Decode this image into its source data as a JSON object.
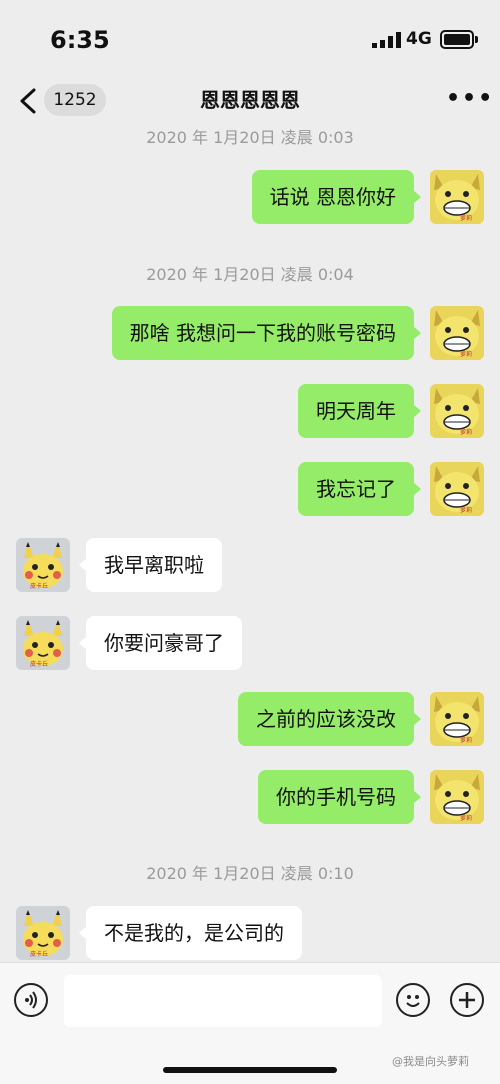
{
  "status_bar": {
    "time": "6:35",
    "network": "4G"
  },
  "nav": {
    "back_count": "1252",
    "title": "恩恩恩恩恩",
    "more_symbol": "•••"
  },
  "timestamps": [
    "2020 年 1月20日 凌晨 0:03",
    "2020 年 1月20日 凌晨 0:04",
    "2020 年 1月20日 凌晨 0:10"
  ],
  "messages": [
    {
      "from": "me",
      "text": "话说 恩恩你好"
    },
    {
      "from": "me",
      "text": "那啥 我想问一下我的账号密码"
    },
    {
      "from": "me",
      "text": "明天周年"
    },
    {
      "from": "me",
      "text": "我忘记了"
    },
    {
      "from": "them",
      "text": "我早离职啦"
    },
    {
      "from": "them",
      "text": "你要问豪哥了"
    },
    {
      "from": "me",
      "text": "之前的应该没改"
    },
    {
      "from": "me",
      "text": "你的手机号码"
    },
    {
      "from": "them",
      "text": "不是我的，是公司的"
    }
  ],
  "avatars": {
    "me_label": "萝莉",
    "them_label": "皮卡丘"
  },
  "watermark": "@我是向头萝莉",
  "colors": {
    "background": "#ededed",
    "my_bubble": "#95ec69",
    "their_bubble": "#ffffff",
    "timestamp": "#9a9a9a"
  },
  "icons": [
    "back-chevron-icon",
    "more-dots-icon",
    "voice-icon",
    "emoji-icon",
    "plus-icon"
  ]
}
